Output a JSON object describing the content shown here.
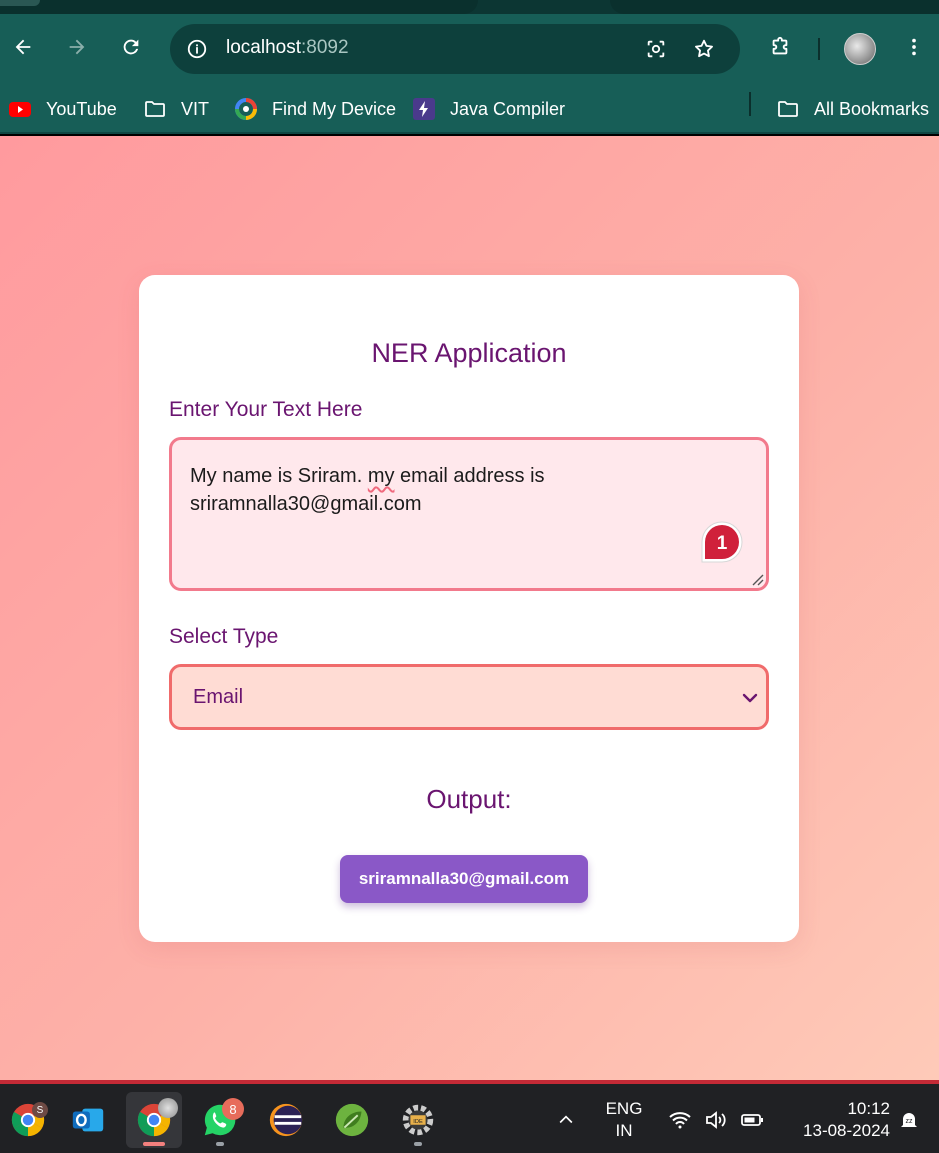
{
  "browser": {
    "url_host": "localhost",
    "url_port": ":8092",
    "bookmarks": [
      {
        "label": "YouTube",
        "icon": "youtube-icon"
      },
      {
        "label": "VIT",
        "icon": "folder-icon"
      },
      {
        "label": "Find My Device",
        "icon": "find-my-device-icon"
      },
      {
        "label": "Java Compiler",
        "icon": "bolt-icon"
      }
    ],
    "all_bookmarks_label": "All Bookmarks"
  },
  "app": {
    "title": "NER Application",
    "input_label": "Enter Your Text Here",
    "input_line1_a": "My name is Sriram. ",
    "input_line1_spell": "my",
    "input_line1_b": " email address is",
    "input_line2": "sriramnalla30@gmail.com",
    "grammar_badge_count": "1",
    "select_label": "Select Type",
    "select_value": "Email",
    "output_heading": "Output:",
    "output_value": "sriramnalla30@gmail.com"
  },
  "colors": {
    "accent_text": "#6a1570",
    "border_pink": "#f27a8c",
    "output_button": "#8a58c7",
    "toolbar": "#175e57"
  },
  "taskbar": {
    "apps": [
      {
        "name": "chrome-profile-s",
        "badge": "S"
      },
      {
        "name": "outlook"
      },
      {
        "name": "chrome"
      },
      {
        "name": "whatsapp",
        "badge": "8"
      },
      {
        "name": "eclipse"
      },
      {
        "name": "spring-tools"
      },
      {
        "name": "javafx-ide"
      }
    ],
    "language_line1": "ENG",
    "language_line2": "IN",
    "time": "10:12",
    "date": "13-08-2024"
  }
}
